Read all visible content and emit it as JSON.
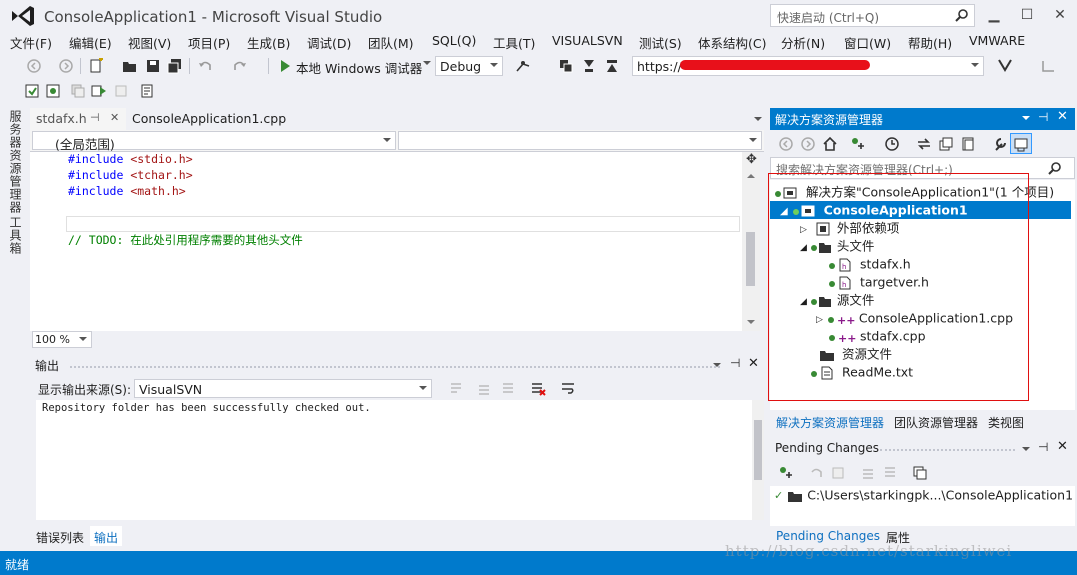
{
  "window": {
    "title": "ConsoleApplication1 - Microsoft Visual Studio",
    "quick_launch_placeholder": "快速启动 (Ctrl+Q)",
    "minimize": "▁",
    "restore": "☐",
    "close": "✕"
  },
  "menu": [
    "文件(F)",
    "编辑(E)",
    "视图(V)",
    "项目(P)",
    "生成(B)",
    "调试(D)",
    "团队(M)",
    "SQL(Q)",
    "工具(T)",
    "VISUALSVN",
    "测试(S)",
    "体系结构(C)",
    "分析(N)",
    "窗口(W)",
    "帮助(H)",
    "VMWARE"
  ],
  "toolbar": {
    "run_label": "本地 Windows 调试器",
    "config": "Debug",
    "url": "https://"
  },
  "editor": {
    "tabs": [
      {
        "label": "stdafx.h",
        "pin": "⊣"
      },
      {
        "label": "ConsoleApplication1.cpp"
      }
    ],
    "scope": "(全局范围)",
    "lines": [
      {
        "kw": "#include",
        "arg": "<stdio.h>"
      },
      {
        "kw": "#include",
        "arg": "<tchar.h>"
      },
      {
        "kw": "#include",
        "arg": "<math.h>"
      }
    ],
    "comment": "// TODO: 在此处引用程序需要的其他头文件",
    "zoom": "100 %"
  },
  "sidebar": {
    "server_explorer": "服务器资源管理器",
    "toolbox": "工具箱"
  },
  "output": {
    "title": "输出",
    "source_label": "显示输出来源(S):",
    "source_value": "VisualSVN",
    "text": "Repository folder has been successfully checked out.",
    "tabs": [
      "错误列表",
      "输出"
    ]
  },
  "solution_explorer": {
    "title": "解决方案资源管理器",
    "search_placeholder": "搜索解决方案资源管理器(Ctrl+;)",
    "nodes": [
      {
        "label": "解决方案\"ConsoleApplication1\"(1 个项目)"
      },
      {
        "label": "ConsoleApplication1"
      },
      {
        "label": "外部依赖项"
      },
      {
        "label": "头文件"
      },
      {
        "label": "stdafx.h"
      },
      {
        "label": "targetver.h"
      },
      {
        "label": "源文件"
      },
      {
        "label": "ConsoleApplication1.cpp"
      },
      {
        "label": "stdafx.cpp"
      },
      {
        "label": "资源文件"
      },
      {
        "label": "ReadMe.txt"
      }
    ],
    "tabs": [
      "解决方案资源管理器",
      "团队资源管理器",
      "类视图"
    ]
  },
  "pending_changes": {
    "title": "Pending Changes",
    "path": "C:\\Users\\starkingpk...\\ConsoleApplication1",
    "tabs": [
      "Pending Changes",
      "属性"
    ]
  },
  "status": {
    "text": "就绪"
  },
  "watermark": "http://blog.csdn.net/starkingliwei",
  "colors": {
    "accent": "#007acc",
    "highlight_box": "#e01010"
  }
}
